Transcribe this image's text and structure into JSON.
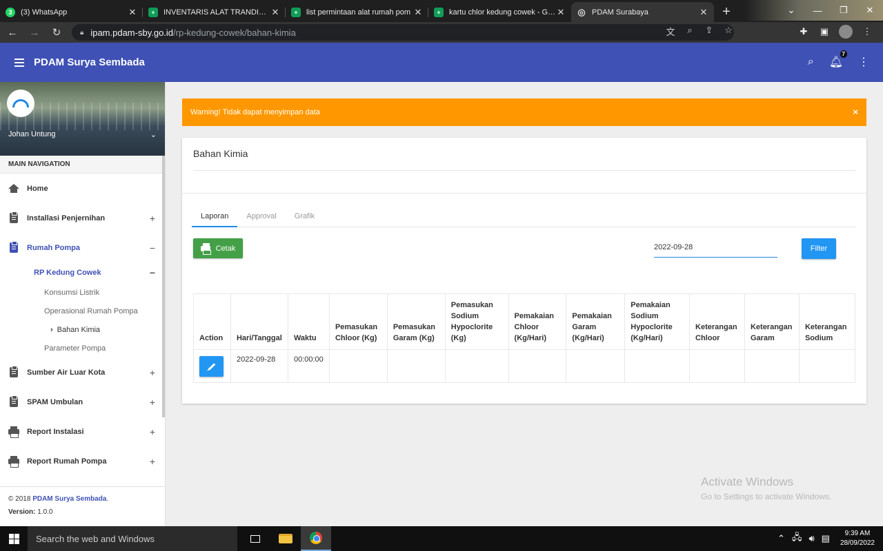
{
  "browser": {
    "tabs": [
      {
        "title": "(3) WhatsApp",
        "icon": "whatsapp-icon",
        "color": "#25d366",
        "glyph": "3"
      },
      {
        "title": "INVENTARIS ALAT TRANDIST - G",
        "icon": "sheets-icon",
        "color": "#0f9d58",
        "glyph": "+"
      },
      {
        "title": "list permintaan alat rumah pom",
        "icon": "sheets-icon",
        "color": "#0f9d58",
        "glyph": "+"
      },
      {
        "title": "kartu chlor kedung cowek - Goo",
        "icon": "sheets-icon",
        "color": "#0f9d58",
        "glyph": "+"
      },
      {
        "title": "PDAM Surabaya",
        "icon": "globe-icon",
        "color": "#5f6368",
        "glyph": "◎"
      }
    ],
    "url_domain": "ipam.pdam-sby.go.id",
    "url_path": "/rp-kedung-cowek/bahan-kimia"
  },
  "header": {
    "brand": "PDAM Surya Sembada",
    "notification_count": "7"
  },
  "sidebar": {
    "user_name": "Johan Untung",
    "nav_heading": "MAIN NAVIGATION",
    "items": [
      {
        "label": "Home"
      },
      {
        "label": "Installasi Penjernihan",
        "toggle": "+"
      },
      {
        "label": "Rumah Pompa",
        "toggle": "−"
      },
      {
        "label": "Sumber Air Luar Kota",
        "toggle": "+"
      },
      {
        "label": "SPAM Umbulan",
        "toggle": "+"
      },
      {
        "label": "Report Instalasi",
        "toggle": "+"
      },
      {
        "label": "Report Rumah Pompa",
        "toggle": "+"
      }
    ],
    "sub": {
      "rp_kedung_cowek": "RP Kedung Cowek",
      "rp_toggle": "−",
      "konsumsi_listrik": "Konsumsi Listrik",
      "operasional": "Operasional Rumah Pompa",
      "bahan_kimia": "Bahan Kimia",
      "parameter_pompa": "Parameter Pompa"
    },
    "footer": {
      "copyright_prefix": "© 2018",
      "copyright_link": "PDAM Surya Sembada",
      "copyright_suffix": ".",
      "version_label": "Version:",
      "version_value": "1.0.0"
    }
  },
  "alert": {
    "message": "Warning! Tidak dapat menyimpan data",
    "close": "×"
  },
  "card": {
    "title": "Bahan Kimia",
    "tabs": [
      "Laporan",
      "Approval",
      "Grafik"
    ],
    "cetak_label": "Cetak",
    "date_value": "2022-09-28",
    "filter_label": "Filter"
  },
  "table": {
    "headers": [
      "Action",
      "Hari/Tanggal",
      "Waktu",
      "Pemasukan Chloor (Kg)",
      "Pemasukan Garam (Kg)",
      "Pemasukan Sodium Hypoclorite (Kg)",
      "Pemakaian Chloor (Kg/Hari)",
      "Pemakaian Garam (Kg/Hari)",
      "Pemakaian Sodium Hypoclorite (Kg/Hari)",
      "Keterangan Chloor",
      "Keterangan Garam",
      "Keterangan Sodium"
    ],
    "rows": [
      {
        "date": "2022-09-28",
        "time": "00:00:00"
      }
    ]
  },
  "watermark": {
    "line1": "Activate Windows",
    "line2": "Go to Settings to activate Windows."
  },
  "taskbar": {
    "search_placeholder": "Search the web and Windows",
    "time": "9:39 AM",
    "date": "28/09/2022"
  },
  "colors": {
    "primary": "#3f51b5",
    "warning": "#ff9800",
    "success": "#43a047",
    "info": "#2196f3"
  }
}
